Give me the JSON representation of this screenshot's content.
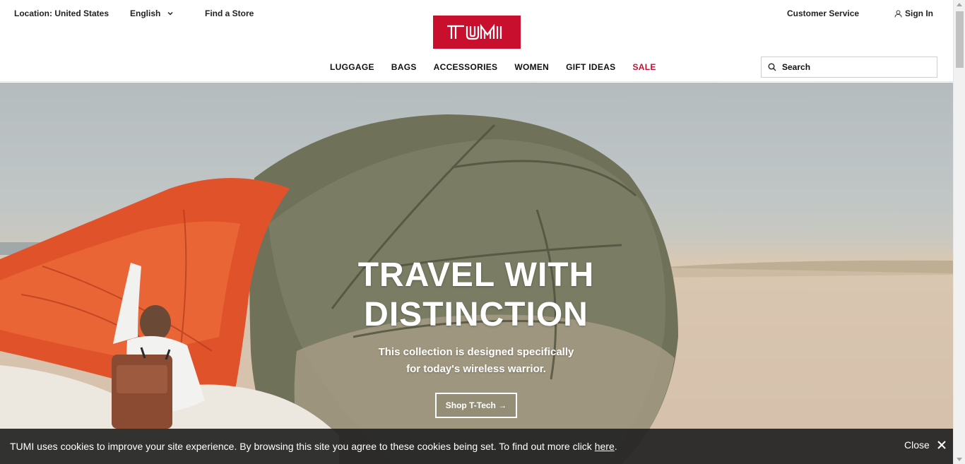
{
  "topbar": {
    "location": "Location: United States",
    "language": "English",
    "find_store": "Find a Store",
    "customer_service": "Customer Service",
    "sign_in": "Sign In"
  },
  "brand": {
    "logo_text": "TUMI",
    "brand_color": "#c8102e"
  },
  "nav": {
    "items": [
      {
        "label": "LUGGAGE"
      },
      {
        "label": "BAGS"
      },
      {
        "label": "ACCESSORIES"
      },
      {
        "label": "WOMEN"
      },
      {
        "label": "GIFT IDEAS"
      },
      {
        "label": "SALE"
      }
    ]
  },
  "search": {
    "placeholder": "Search"
  },
  "hero": {
    "title_line1": "TRAVEL WITH",
    "title_line2": "DISTINCTION",
    "subtitle_line1": "This collection is designed specifically",
    "subtitle_line2": "for today's wireless warrior.",
    "cta_label": "Shop T-Tech →"
  },
  "cookie_bar": {
    "message": "TUMI uses cookies to improve your site experience. By browsing this site you agree to these cookies being set. To find out more click ",
    "link_text": "here",
    "message_end": ".",
    "close_label": "Close"
  },
  "icons": {
    "language_chevron": "chevron-down-icon",
    "sign_in": "user-icon",
    "search": "search-icon",
    "cookie_close": "close-icon"
  }
}
